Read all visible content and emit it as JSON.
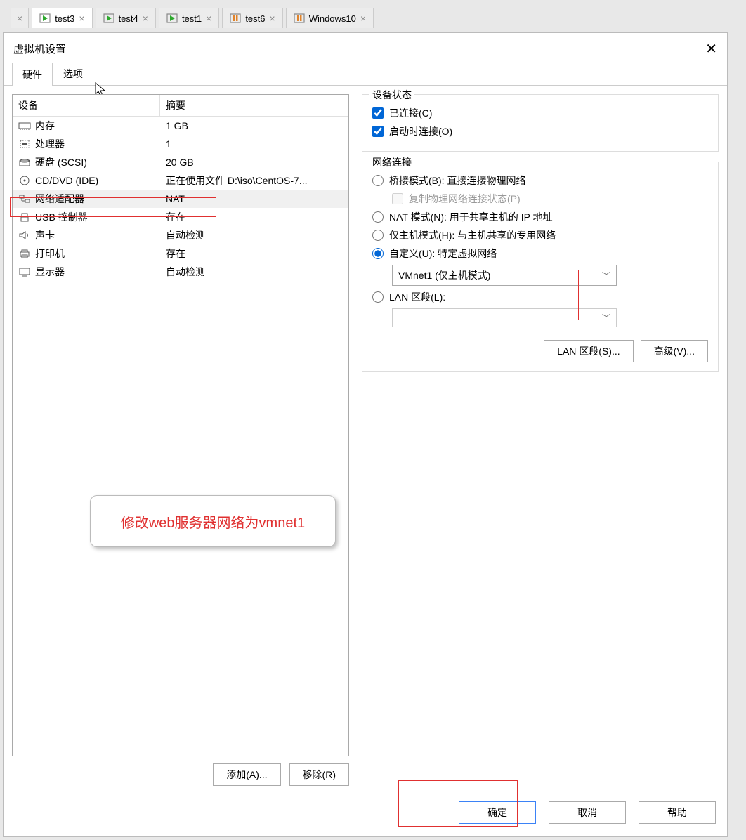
{
  "tabs": [
    {
      "label": "test3",
      "active": true,
      "close_visible": true
    },
    {
      "label": "test4",
      "active": false,
      "close_visible": true
    },
    {
      "label": "test1",
      "active": false,
      "close_visible": true
    },
    {
      "label": "test6",
      "active": false,
      "close_visible": true
    },
    {
      "label": "Windows10",
      "active": false,
      "close_visible": true
    }
  ],
  "dialog": {
    "title": "虚拟机设置",
    "tabs": {
      "hardware": "硬件",
      "options": "选项"
    },
    "device_header": {
      "device": "设备",
      "summary": "摘要"
    },
    "devices": [
      {
        "icon": "memory-icon",
        "name": "内存",
        "summary": "1 GB"
      },
      {
        "icon": "cpu-icon",
        "name": "处理器",
        "summary": "1"
      },
      {
        "icon": "disk-icon",
        "name": "硬盘 (SCSI)",
        "summary": "20 GB"
      },
      {
        "icon": "cd-icon",
        "name": "CD/DVD (IDE)",
        "summary": "正在使用文件 D:\\iso\\CentOS-7..."
      },
      {
        "icon": "network-icon",
        "name": "网络适配器",
        "summary": "NAT",
        "selected": true
      },
      {
        "icon": "usb-icon",
        "name": "USB 控制器",
        "summary": "存在"
      },
      {
        "icon": "sound-icon",
        "name": "声卡",
        "summary": "自动检测"
      },
      {
        "icon": "printer-icon",
        "name": "打印机",
        "summary": "存在"
      },
      {
        "icon": "display-icon",
        "name": "显示器",
        "summary": "自动检测"
      }
    ],
    "annotation": "修改web服务器网络为vmnet1",
    "add_btn": "添加(A)...",
    "remove_btn": "移除(R)",
    "device_status": {
      "legend": "设备状态",
      "connected": "已连接(C)",
      "connect_at_power_on": "启动时连接(O)"
    },
    "network": {
      "legend": "网络连接",
      "bridged": "桥接模式(B): 直接连接物理网络",
      "replicate": "复制物理网络连接状态(P)",
      "nat": "NAT 模式(N): 用于共享主机的 IP 地址",
      "host_only": "仅主机模式(H): 与主机共享的专用网络",
      "custom": "自定义(U): 特定虚拟网络",
      "custom_value": "VMnet1 (仅主机模式)",
      "lan_segment": "LAN 区段(L):",
      "lan_segments_btn": "LAN 区段(S)...",
      "advanced_btn": "高级(V)..."
    },
    "footer": {
      "ok": "确定",
      "cancel": "取消",
      "help": "帮助"
    }
  }
}
